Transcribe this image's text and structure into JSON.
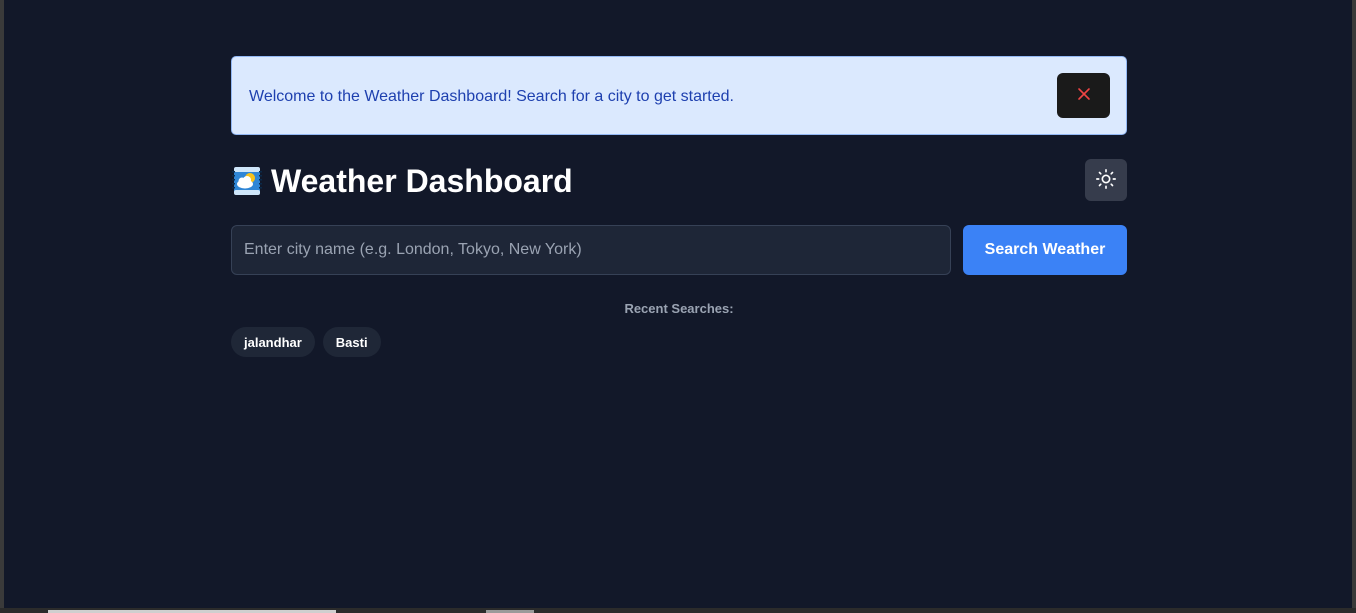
{
  "alert": {
    "message": "Welcome to the Weather Dashboard! Search for a city to get started.",
    "close_icon": "close-icon",
    "close_color": "#ef4444"
  },
  "header": {
    "logo_icon": "weather-app-icon",
    "title": "Weather Dashboard",
    "theme_toggle_icon": "sun-icon"
  },
  "search": {
    "placeholder": "Enter city name (e.g. London, Tokyo, New York)",
    "value": "",
    "button_label": "Search Weather",
    "accent": "#3b82f6"
  },
  "recent": {
    "label": "Recent Searches:",
    "items": [
      "jalandhar",
      "Basti"
    ]
  }
}
